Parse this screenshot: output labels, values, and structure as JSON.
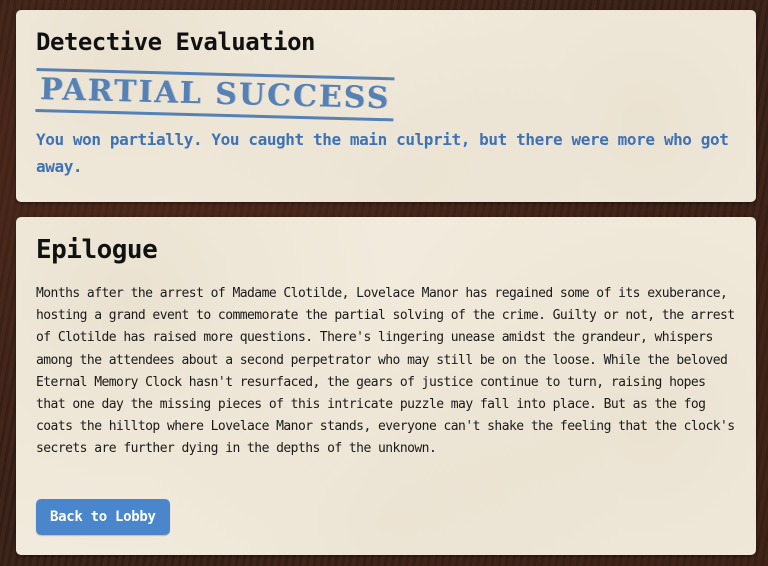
{
  "evaluation": {
    "title": "Detective Evaluation",
    "stamp": "PARTIAL SUCCESS",
    "message": "You won partially. You caught the main culprit, but there were more who got away."
  },
  "epilogue": {
    "title": "Epilogue",
    "body": "Months after the arrest of Madame Clotilde, Lovelace Manor has regained some of its exuberance, hosting a grand event to commemorate the partial solving of the crime. Guilty or not, the arrest of Clotilde has raised more questions. There's lingering unease amidst the grandeur, whispers among the attendees about a second perpetrator who may still be on the loose. While the beloved Eternal Memory Clock hasn't resurfaced, the gears of justice continue to turn, raising hopes that one day the missing pieces of this intricate puzzle may fall into place. But as the fog coats the hilltop where Lovelace Manor stands, everyone can't shake the feeling that the clock's secrets are further dying in the depths of the unknown.",
    "back_button_label": "Back to Lobby"
  },
  "colors": {
    "accent_blue": "#4a86cc",
    "stamp_blue": "#4a79b5",
    "paper": "#f2ebdd",
    "background": "#3a2117"
  }
}
